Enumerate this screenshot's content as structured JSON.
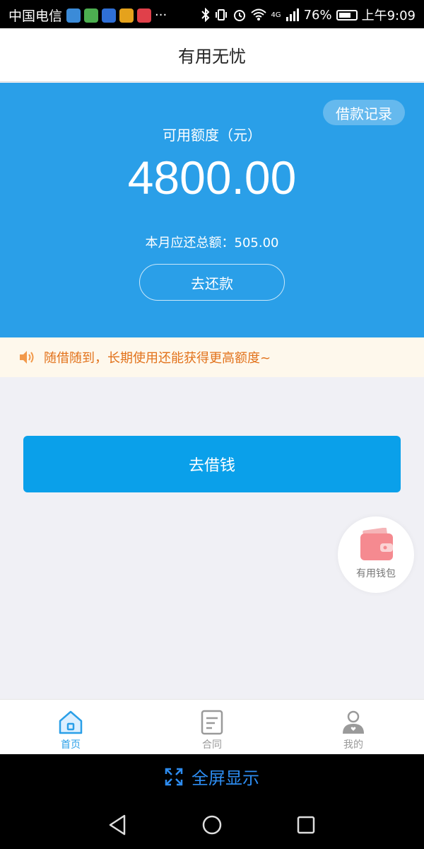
{
  "status_bar": {
    "carrier": "中国电信",
    "more": "···",
    "network": "4G",
    "battery": "76%",
    "time": "上午9:09"
  },
  "header": {
    "title": "有用无忧"
  },
  "hero": {
    "record_button": "借款记录",
    "available_label": "可用额度（元）",
    "available_amount": "4800.00",
    "monthly_due": "本月应还总额：505.00",
    "repay_button": "去还款"
  },
  "notice": {
    "text": "随借随到，长期使用还能获得更高额度~"
  },
  "borrow_button": "去借钱",
  "wallet_float": {
    "label": "有用钱包"
  },
  "tabs": [
    {
      "label": "首页",
      "icon": "home-icon",
      "active": true
    },
    {
      "label": "合同",
      "icon": "contract-icon",
      "active": false
    },
    {
      "label": "我的",
      "icon": "user-icon",
      "active": false
    }
  ],
  "overlay": {
    "fullscreen_label": "全屏显示"
  },
  "colors": {
    "primary": "#2a9fe8",
    "button": "#0aa0ea",
    "notice_text": "#e2721b",
    "notice_bg": "#fef8ec"
  }
}
